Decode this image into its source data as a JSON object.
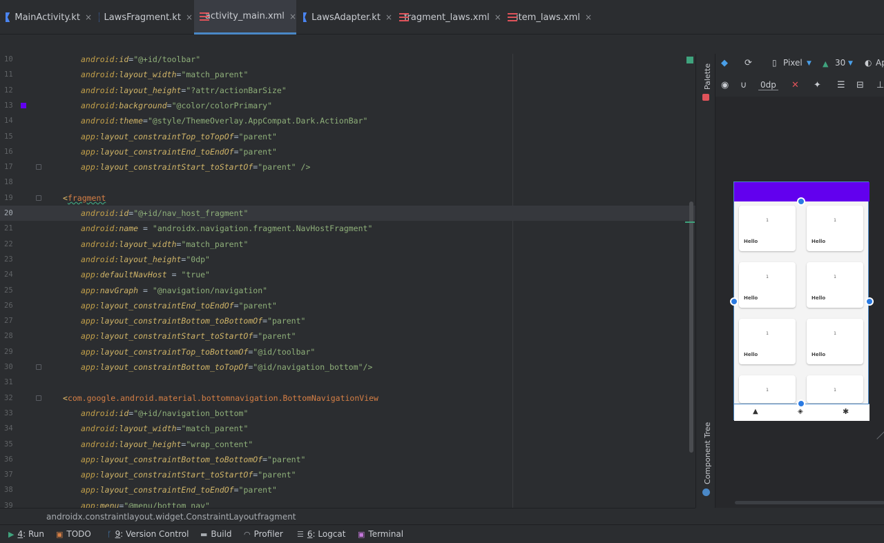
{
  "tabs": [
    {
      "label": "MainActivity.kt",
      "type": "kt"
    },
    {
      "label": "LawsFragment.kt",
      "type": "kt"
    },
    {
      "label": "activity_main.xml",
      "type": "xml",
      "active": true
    },
    {
      "label": "LawsAdapter.kt",
      "type": "kt"
    },
    {
      "label": "fragment_laws.xml",
      "type": "xml"
    },
    {
      "label": "item_laws.xml",
      "type": "xml"
    }
  ],
  "close_glyph": "×",
  "editor": {
    "current_line": 20,
    "lines": [
      {
        "n": "10",
        "p": "android",
        "a": "id",
        "eq": "=",
        "v": "\"@+id/toolbar\""
      },
      {
        "n": "11",
        "p": "android",
        "a": "layout_width",
        "eq": "=",
        "v": "\"match_parent\""
      },
      {
        "n": "12",
        "p": "android",
        "a": "layout_height",
        "eq": "=",
        "v": "\"?attr/actionBarSize\""
      },
      {
        "n": "13",
        "p": "android",
        "a": "background",
        "eq": "=",
        "v": "\"@color/colorPrimary\""
      },
      {
        "n": "14",
        "p": "android",
        "a": "theme",
        "eq": "=",
        "v": "\"@style/ThemeOverlay.AppCompat.Dark.ActionBar\""
      },
      {
        "n": "15",
        "p": "app",
        "a": "layout_constraintTop_toTopOf",
        "eq": "=",
        "v": "\"parent\""
      },
      {
        "n": "16",
        "p": "app",
        "a": "layout_constraintEnd_toEndOf",
        "eq": "=",
        "v": "\"parent\""
      },
      {
        "n": "17",
        "p": "app",
        "a": "layout_constraintStart_toStartOf",
        "eq": "=",
        "v": "\"parent\" />"
      },
      {
        "n": "18"
      },
      {
        "n": "19",
        "tag": "<",
        "tagname": "fragment"
      },
      {
        "n": "20",
        "p": "android",
        "a": "id",
        "eq": "=",
        "v": "\"@+id/nav_host_fragment\""
      },
      {
        "n": "21",
        "p": "android",
        "a": "name",
        "eq": " = ",
        "v": "\"androidx.navigation.fragment.NavHostFragment\""
      },
      {
        "n": "22",
        "p": "android",
        "a": "layout_width",
        "eq": "=",
        "v": "\"match_parent\""
      },
      {
        "n": "23",
        "p": "android",
        "a": "layout_height",
        "eq": "=",
        "v": "\"0dp\""
      },
      {
        "n": "24",
        "p": "app",
        "a": "defaultNavHost",
        "eq": " = ",
        "v": "\"true\""
      },
      {
        "n": "25",
        "p": "app",
        "a": "navGraph",
        "eq": " = ",
        "v": "\"@navigation/navigation\""
      },
      {
        "n": "26",
        "p": "app",
        "a": "layout_constraintEnd_toEndOf",
        "eq": "=",
        "v": "\"parent\""
      },
      {
        "n": "27",
        "p": "app",
        "a": "layout_constraintBottom_toBottomOf",
        "eq": "=",
        "v": "\"parent\""
      },
      {
        "n": "28",
        "p": "app",
        "a": "layout_constraintStart_toStartOf",
        "eq": "=",
        "v": "\"parent\""
      },
      {
        "n": "29",
        "p": "app",
        "a": "layout_constraintTop_toBottomOf",
        "eq": "=",
        "v": "\"@id/toolbar\""
      },
      {
        "n": "30",
        "p": "app",
        "a": "layout_constraintBottom_toTopOf",
        "eq": "=",
        "v": "\"@id/navigation_bottom\"/>"
      },
      {
        "n": "31"
      },
      {
        "n": "32",
        "tag": "<",
        "tagname": "com.google.android.material.bottomnavigation.BottomNavigationView"
      },
      {
        "n": "33",
        "p": "android",
        "a": "id",
        "eq": "=",
        "v": "\"@+id/navigation_bottom\""
      },
      {
        "n": "34",
        "p": "android",
        "a": "layout_width",
        "eq": "=",
        "v": "\"match_parent\""
      },
      {
        "n": "35",
        "p": "android",
        "a": "layout_height",
        "eq": "=",
        "v": "\"wrap_content\""
      },
      {
        "n": "36",
        "p": "app",
        "a": "layout_constraintBottom_toBottomOf",
        "eq": "=",
        "v": "\"parent\""
      },
      {
        "n": "37",
        "p": "app",
        "a": "layout_constraintStart_toStartOf",
        "eq": "=",
        "v": "\"parent\""
      },
      {
        "n": "38",
        "p": "app",
        "a": "layout_constraintEnd_toEndOf",
        "eq": "=",
        "v": "\"parent\""
      },
      {
        "n": "39",
        "p": "app",
        "a": "menu",
        "eq": "=",
        "v": "\"@menu/bottom_nav\""
      }
    ]
  },
  "breadcrumb": {
    "items": [
      "androidx.constraintlayout.widget.ConstraintLayout",
      "fragment"
    ]
  },
  "side_strip": {
    "palette_label": "Palette",
    "component_tree_label": "Component Tree"
  },
  "design": {
    "device": "Pixel",
    "api_level": "30",
    "theme_partial": "Ap",
    "margin": "0dp",
    "preview": {
      "primary_color": "#6200ee",
      "cards": [
        {
          "num": "1",
          "label": "Hello"
        },
        {
          "num": "1",
          "label": "Hello"
        },
        {
          "num": "1",
          "label": "Hello"
        },
        {
          "num": "1",
          "label": "Hello"
        },
        {
          "num": "1",
          "label": "Hello"
        },
        {
          "num": "1",
          "label": "Hello"
        },
        {
          "num": "1",
          "label": ""
        },
        {
          "num": "1",
          "label": ""
        }
      ]
    }
  },
  "status": {
    "items": [
      {
        "icon": "run-icon",
        "key": "4",
        "label": ": Run"
      },
      {
        "icon": "todo-icon",
        "key": "",
        "label": "TODO"
      },
      {
        "icon": "vcs-icon",
        "key": "9",
        "label": ": Version Control"
      },
      {
        "icon": "build-icon",
        "key": "",
        "label": "Build"
      },
      {
        "icon": "profiler-icon",
        "key": "",
        "label": "Profiler"
      },
      {
        "icon": "logcat-icon",
        "key": "6",
        "label": ": Logcat"
      },
      {
        "icon": "terminal-icon",
        "key": "",
        "label": "Terminal"
      }
    ]
  },
  "colors": {
    "accent": "#4a88c7",
    "brand_primary": "#6200ee",
    "marker_green": "#3fa37d"
  }
}
